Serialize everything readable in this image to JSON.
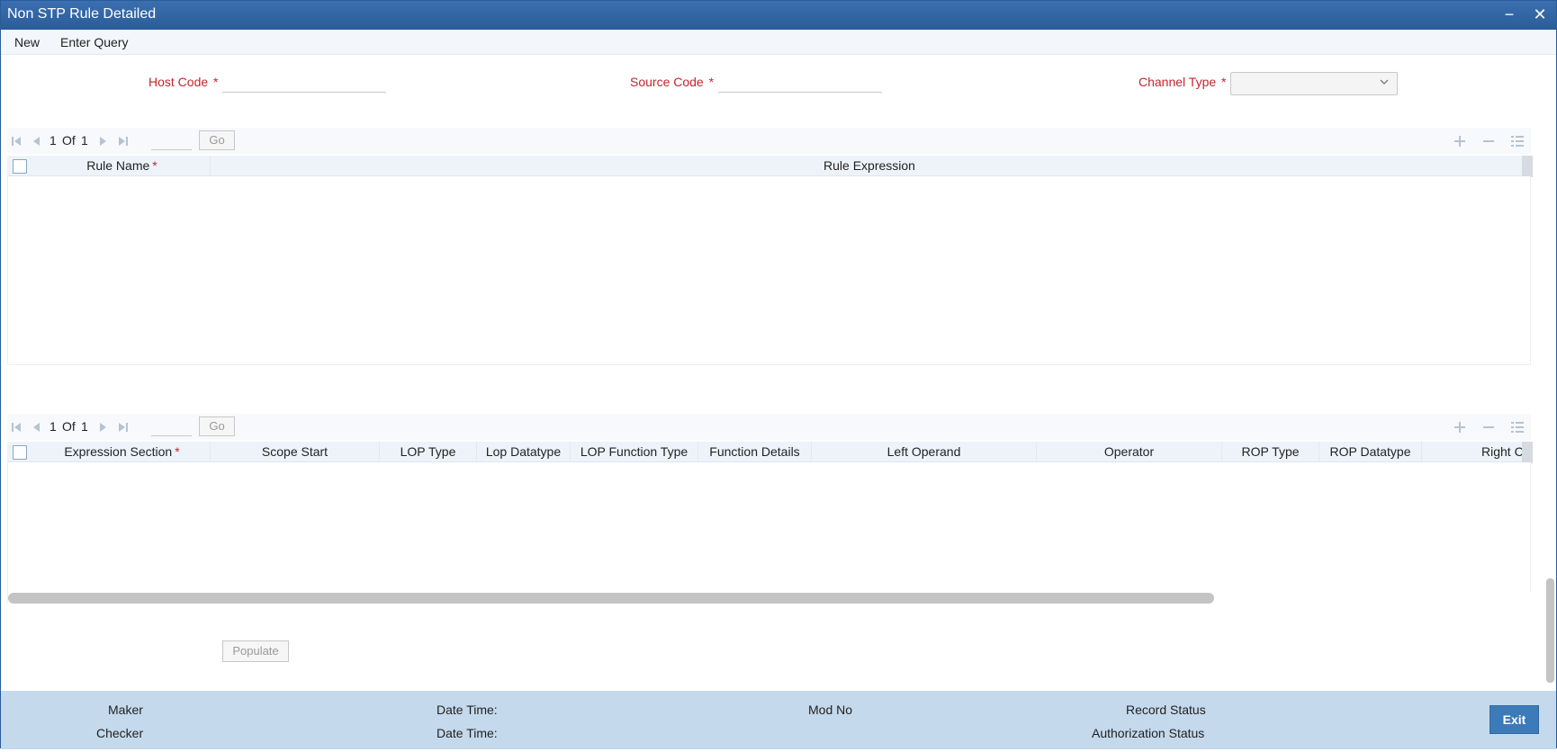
{
  "window": {
    "title": "Non STP Rule Detailed",
    "minimize_label": "−",
    "close_label": "✕"
  },
  "menu": {
    "items": [
      "New",
      "Enter Query"
    ]
  },
  "form": {
    "host_code": {
      "label": "Host Code",
      "required": "*",
      "value": ""
    },
    "source_code": {
      "label": "Source Code",
      "required": "*",
      "value": ""
    },
    "channel_type": {
      "label": "Channel Type",
      "required": "*",
      "value": ""
    }
  },
  "rules_grid": {
    "pager": {
      "current": "1",
      "of_label": "Of",
      "total": "1",
      "go_label": "Go",
      "page_input": ""
    },
    "columns": [
      {
        "label": "Rule Name",
        "required": "*"
      },
      {
        "label": "Rule Expression",
        "required": ""
      }
    ],
    "rows": []
  },
  "expressions_grid": {
    "pager": {
      "current": "1",
      "of_label": "Of",
      "total": "1",
      "go_label": "Go",
      "page_input": ""
    },
    "columns": [
      {
        "label": "Expression Section",
        "required": "*"
      },
      {
        "label": "Scope Start",
        "required": ""
      },
      {
        "label": "LOP Type",
        "required": ""
      },
      {
        "label": "Lop Datatype",
        "required": ""
      },
      {
        "label": "LOP Function Type",
        "required": ""
      },
      {
        "label": "Function Details",
        "required": ""
      },
      {
        "label": "Left Operand",
        "required": ""
      },
      {
        "label": "Operator",
        "required": ""
      },
      {
        "label": "ROP Type",
        "required": ""
      },
      {
        "label": "ROP Datatype",
        "required": ""
      },
      {
        "label": "Right C",
        "required": ""
      }
    ],
    "rows": []
  },
  "actions": {
    "populate_label": "Populate"
  },
  "footer": {
    "maker_label": "Maker",
    "checker_label": "Checker",
    "date_time_label_1": "Date Time:",
    "date_time_label_2": "Date Time:",
    "mod_no_label": "Mod No",
    "record_status_label": "Record Status",
    "authorization_status_label": "Authorization Status",
    "exit_label": "Exit"
  },
  "colors": {
    "title_bar": "#2b5c99",
    "required_label": "#c0262d",
    "footer_bg": "#c4d9ec",
    "exit_button": "#3d7ab8"
  },
  "icons": {
    "pager": [
      "first-page-icon",
      "prev-page-icon",
      "next-page-icon",
      "last-page-icon"
    ],
    "tools": [
      "add-row-icon",
      "delete-row-icon",
      "single-view-icon"
    ]
  }
}
